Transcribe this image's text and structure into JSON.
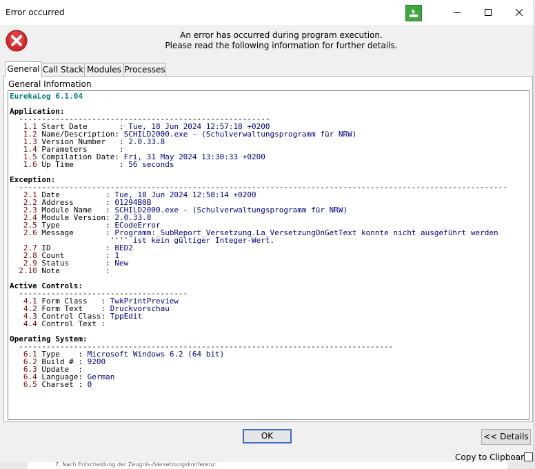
{
  "window": {
    "title": "Error occurred",
    "minimize_icon": "minimize-icon",
    "maximize_icon": "maximize-icon",
    "close_icon": "close-icon"
  },
  "header": {
    "line1": "An error has occurred during program execution.",
    "line2": "Please read the following information for further details."
  },
  "tabs": [
    {
      "label": "General",
      "active": true
    },
    {
      "label": "Call Stack",
      "active": false
    },
    {
      "label": "Modules",
      "active": false
    },
    {
      "label": "Processes",
      "active": false
    }
  ],
  "general_info_label": "General Information",
  "log": {
    "version": "EurekaLog 6.1.04",
    "sections": [
      {
        "heading": "Application:",
        "rule": "-------------------------------------------------------",
        "rows": [
          {
            "num": "1.1",
            "name": "Start Date       ",
            "value": "Tue, 18 Jun 2024 12:57:18 +0200"
          },
          {
            "num": "1.2",
            "name": "Name/Description:",
            "value": "SCHILD2000.exe - (Schulverwaltungsprogramm für NRW)",
            "sep": " "
          },
          {
            "num": "1.3",
            "name": "Version Number   ",
            "value": "2.0.33.8"
          },
          {
            "num": "1.4",
            "name": "Parameters       ",
            "value": ""
          },
          {
            "num": "1.5",
            "name": "Compilation Date:",
            "value": "Fri, 31 May 2024 13:30:33 +0200",
            "sep": " "
          },
          {
            "num": "1.6",
            "name": "Up Time          ",
            "value": "56 seconds"
          }
        ]
      },
      {
        "heading": "Exception:",
        "rule": "-----------------------------------------------------------------------------------------------------------",
        "rows": [
          {
            "num": "2.1",
            "name": "Date          ",
            "value": "Tue, 18 Jun 2024 12:58:14 +0200"
          },
          {
            "num": "2.2",
            "name": "Address       ",
            "value": "01294B0B"
          },
          {
            "num": "2.3",
            "name": "Module Name   ",
            "value": "SCHILD2000.exe - (Schulverwaltungsprogramm für NRW)"
          },
          {
            "num": "2.4",
            "name": "Module Version",
            "value": "2.0.33.8"
          },
          {
            "num": "2.5",
            "name": "Type          ",
            "value": "ECodeError"
          },
          {
            "num": "2.6",
            "name": "Message       ",
            "value": "Programm:_SubReport_Versetzung.La_VersetzungOnGetText konnte nicht ausgeführt werden",
            "cont": "'''' ist kein gültiger Integer-Wert."
          },
          {
            "num": "2.7",
            "name": "ID            ",
            "value": "BED2"
          },
          {
            "num": "2.8",
            "name": "Count         ",
            "value": "1"
          },
          {
            "num": "2.9",
            "name": "Status        ",
            "value": "New"
          },
          {
            "num": "2.10",
            "name": "Note          ",
            "value": ""
          }
        ]
      },
      {
        "heading": "Active Controls:",
        "rule": "-------------------------------------",
        "rows": [
          {
            "num": "4.1",
            "name": "Form Class   ",
            "value": "TwkPrintPreview"
          },
          {
            "num": "4.2",
            "name": "Form Text    ",
            "value": "Druckvorschau"
          },
          {
            "num": "4.3",
            "name": "Control Class:",
            "value": "TppEdit",
            "sep": " "
          },
          {
            "num": "4.4",
            "name": "Control Text ",
            "value": ""
          }
        ]
      },
      {
        "heading": "Operating System:",
        "rule": "----------------------------------------------------------------------------------",
        "rows": [
          {
            "num": "6.1",
            "name": "Type    ",
            "value": "Microsoft Windows 6.2 (64 bit)"
          },
          {
            "num": "6.2",
            "name": "Build # ",
            "value": "9200"
          },
          {
            "num": "6.3",
            "name": "Update  ",
            "value": ""
          },
          {
            "num": "6.4",
            "name": "Language:",
            "value": "German",
            "sep": " "
          },
          {
            "num": "6.5",
            "name": "Charset ",
            "value": "0"
          }
        ]
      }
    ]
  },
  "buttons": {
    "ok": "OK",
    "details": "<< Details"
  },
  "copy_to_clipboard": "Copy to Clipboard",
  "background_text": "7. Nach Entscheidung der Zeugnis-/Versetzungskonferenz:",
  "colors": {
    "heading": "#000000",
    "version": "#008080",
    "number": "#800000",
    "value": "#000080",
    "error_icon": "#d9262c",
    "app_icon": "#3ea83e"
  }
}
